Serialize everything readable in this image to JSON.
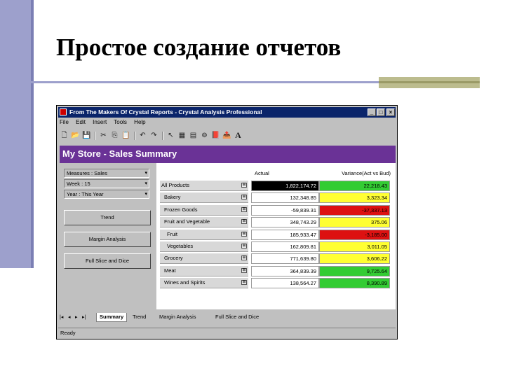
{
  "slide": {
    "title": "Простое создание отчетов"
  },
  "window": {
    "title": "From The Makers Of Crystal Reports - Crystal Analysis Professional",
    "controls": {
      "minimize": "_",
      "maximize": "□",
      "close": "×"
    },
    "menu": [
      "File",
      "Edit",
      "Insert",
      "Tools",
      "Help"
    ],
    "toolbar_icons": [
      "new-icon",
      "open-icon",
      "save-icon",
      "cut-icon",
      "copy-icon",
      "paste-icon",
      "undo-icon",
      "redo-icon",
      "pointer-icon",
      "grid-icon",
      "chart-icon",
      "explore-icon",
      "book-icon",
      "export-icon",
      "text-icon"
    ],
    "toolbar_glyphs": [
      "🗋",
      "📂",
      "💾",
      "✂",
      "⎘",
      "📋",
      "↶",
      "↷",
      "↖",
      "▦",
      "▤",
      "⊚",
      "📕",
      "📤",
      "A"
    ]
  },
  "report": {
    "header": "My Store - Sales Summary",
    "header_color": "#6a3296",
    "dimensions": [
      "Measures : Sales",
      "Week : 15",
      "Year : This Year"
    ],
    "nav_buttons": [
      "Trend",
      "Margin Analysis",
      "Full Slice and Dice"
    ],
    "columns": [
      "Actual",
      "Variance(Act vs Bud)"
    ],
    "rows": [
      {
        "label": "All Products",
        "actual": "1,822,174.72",
        "variance": "22,218.43",
        "actual_bg": "#000000",
        "actual_fg": "#ffffff",
        "var_bg": "#33cc33"
      },
      {
        "label": "Bakery",
        "actual": "132,348.85",
        "variance": "3,323.34",
        "actual_bg": "#ffffff",
        "actual_fg": "#000000",
        "var_bg": "#ffff33"
      },
      {
        "label": "Frozen Goods",
        "actual": "-59,839.31",
        "variance": "-37,337.13",
        "actual_bg": "#ffffff",
        "actual_fg": "#000000",
        "var_bg": "#dd1111"
      },
      {
        "label": "Fruit and Vegetable",
        "actual": "348,743.29",
        "variance": "375.06",
        "actual_bg": "#ffffff",
        "actual_fg": "#000000",
        "var_bg": "#ffff33"
      },
      {
        "label": "Fruit",
        "actual": "185,933.47",
        "variance": "-3,185.00",
        "actual_bg": "#ffffff",
        "actual_fg": "#000000",
        "var_bg": "#dd1111"
      },
      {
        "label": "Vegetables",
        "actual": "162,809.81",
        "variance": "3,011.05",
        "actual_bg": "#ffffff",
        "actual_fg": "#000000",
        "var_bg": "#ffff33"
      },
      {
        "label": "Grocery",
        "actual": "771,639.80",
        "variance": "3,606.22",
        "actual_bg": "#ffffff",
        "actual_fg": "#000000",
        "var_bg": "#ffff33"
      },
      {
        "label": "Meat",
        "actual": "364,839.39",
        "variance": "9,725.64",
        "actual_bg": "#ffffff",
        "actual_fg": "#000000",
        "var_bg": "#33cc33"
      },
      {
        "label": "Wines and Spirits",
        "actual": "138,564.27",
        "variance": "8,390.89",
        "actual_bg": "#ffffff",
        "actual_fg": "#000000",
        "var_bg": "#33cc33"
      }
    ]
  },
  "sheet_tabs": {
    "nav": [
      "|◂",
      "◂",
      "▸",
      "▸|"
    ],
    "tabs": [
      "Summary",
      "Trend",
      "Margin Analysis",
      "Full Slice and Dice"
    ],
    "active": "Summary"
  },
  "status": "Ready"
}
